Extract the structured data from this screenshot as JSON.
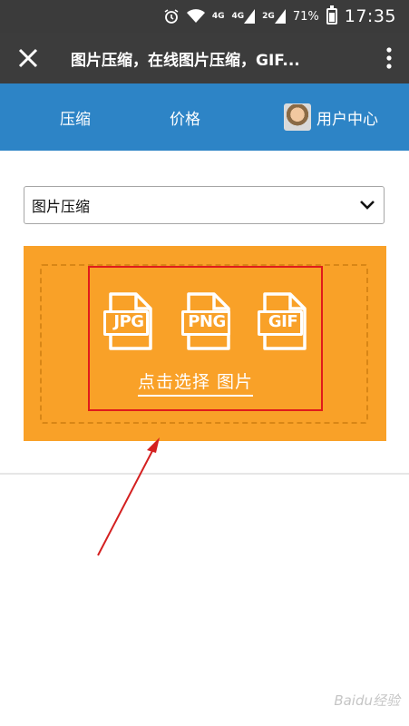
{
  "status_bar": {
    "network1": "4G",
    "network2": "4G",
    "network3": "2G",
    "battery": "71%",
    "time": "17:35"
  },
  "titlebar": {
    "title": "图片压缩，在线图片压缩，GIF..."
  },
  "nav": {
    "items": [
      {
        "label": "压缩"
      },
      {
        "label": "价格"
      },
      {
        "label": "用户中心"
      }
    ]
  },
  "select": {
    "value": "图片压缩"
  },
  "upload": {
    "formats": [
      "JPG",
      "PNG",
      "GIF"
    ],
    "pick_label": "点击选择 图片"
  },
  "watermark": "Baidu经验",
  "colors": {
    "nav_blue": "#2d84c6",
    "upload_orange": "#f9a128",
    "annotation_red": "#e01b1b"
  }
}
